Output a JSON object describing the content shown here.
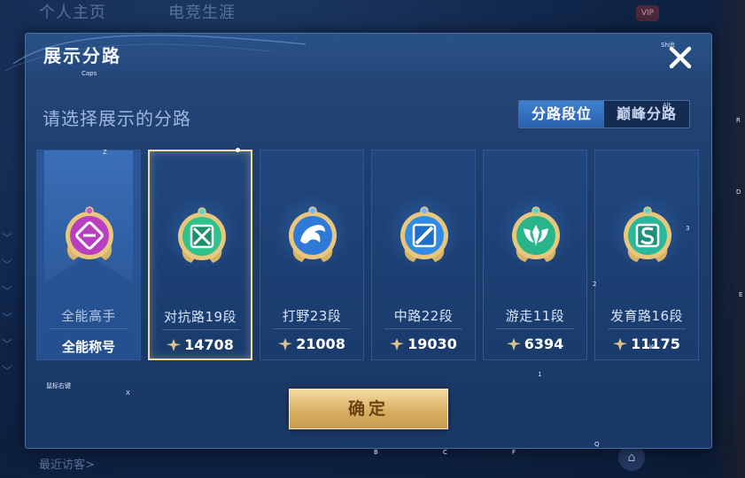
{
  "background": {
    "tabs": [
      "个人主页",
      "电竞生涯"
    ],
    "vip": "VIP",
    "footer": "最近访客>"
  },
  "dialog": {
    "title": "展示分路",
    "subtitle": "请选择展示的分路",
    "toggle": {
      "options": [
        "分路段位",
        "巅峰分路"
      ],
      "active_index": 0
    },
    "cards": [
      {
        "name": "全能高手",
        "label": "全能称号",
        "icon": "all-round-badge",
        "color": "#b83fc0"
      },
      {
        "name": "对抗路19段",
        "score": "14708",
        "icon": "clash-lane-badge",
        "color": "#2fc28a",
        "selected": true
      },
      {
        "name": "打野23段",
        "score": "21008",
        "icon": "jungle-badge",
        "color": "#2f7ad8"
      },
      {
        "name": "中路22段",
        "score": "19030",
        "icon": "mid-lane-badge",
        "color": "#2f8ce6"
      },
      {
        "name": "游走11段",
        "score": "6394",
        "icon": "roam-badge",
        "color": "#28b58a"
      },
      {
        "name": "发育路16段",
        "score": "11175",
        "icon": "farm-lane-badge",
        "color": "#2ab89c"
      }
    ],
    "confirm_label": "确定"
  },
  "key_hints": {
    "caps": "Caps",
    "shift": "Shift",
    "alt": "Alt",
    "z": "Z",
    "x": "X",
    "r": "R",
    "d": "D",
    "e": "E",
    "three": "3",
    "two": "2",
    "one": "1",
    "b": "B",
    "c": "C",
    "f": "F",
    "q": "Q",
    "w": "W",
    "mouse": "鼠标右键"
  }
}
